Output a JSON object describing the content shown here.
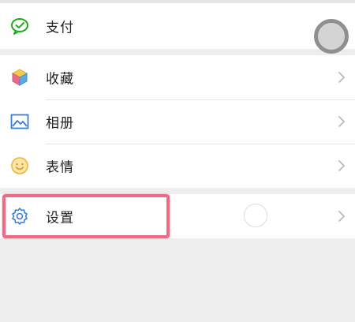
{
  "menu": {
    "pay": {
      "label": "支付",
      "icon": "wechat-pay-icon",
      "color": "#1aad19"
    },
    "items": [
      {
        "label": "收藏",
        "icon": "favorites-cube-icon"
      },
      {
        "label": "相册",
        "icon": "album-picture-icon",
        "color": "#3b7fd1"
      },
      {
        "label": "表情",
        "icon": "emoji-smile-icon",
        "color": "#f0b94a"
      }
    ],
    "settings": {
      "label": "设置",
      "icon": "gear-icon",
      "color": "#3b7fd1"
    }
  },
  "annotation": {
    "highlight_color": "#ef6a85"
  }
}
